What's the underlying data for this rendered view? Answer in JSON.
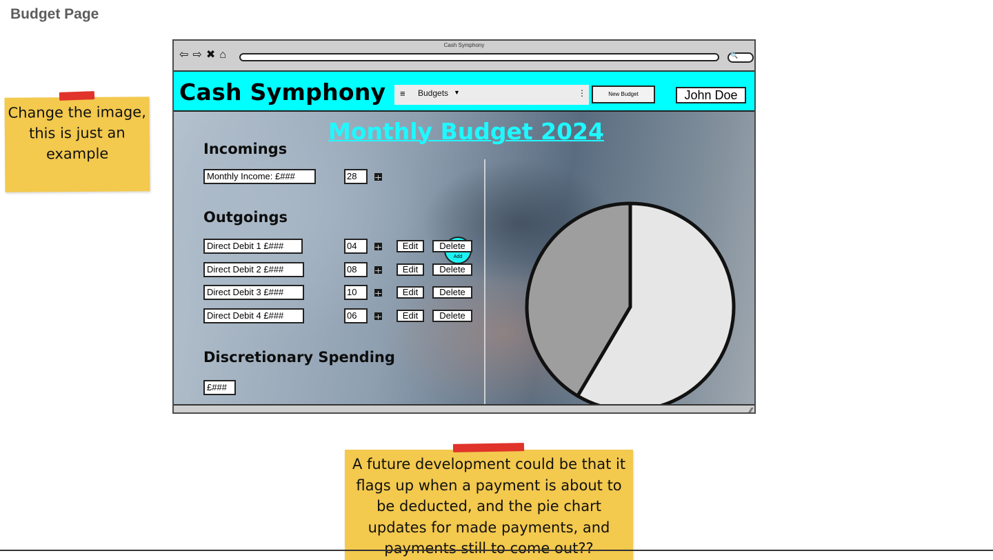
{
  "page_label": "Budget Page",
  "notes": {
    "image_note": "Change the image, this is just an example",
    "future_note": "A future development could be that it flags up when a payment is about to be deducted, and the pie chart updates for made payments, and payments still to come out??"
  },
  "browser": {
    "window_title": "Cash Symphony",
    "nav_icons": [
      "back-icon",
      "forward-icon",
      "close-icon",
      "home-icon"
    ]
  },
  "header": {
    "brand": "Cash Symphony",
    "menu_label": "Budgets",
    "new_budget_label": "New Budget",
    "user_name": "John Doe"
  },
  "main": {
    "title": "Monthly Budget 2024",
    "incomings": {
      "heading": "Incomings",
      "income_field": "Monthly Income: £###",
      "day": "28"
    },
    "outgoings": {
      "heading": "Outgoings",
      "add_label": "Add",
      "edit_label": "Edit",
      "delete_label": "Delete",
      "items": [
        {
          "label": "Direct Debit 1 £###",
          "day": "04"
        },
        {
          "label": "Direct Debit 2 £###",
          "day": "08"
        },
        {
          "label": "Direct Debit 3 £###",
          "day": "10"
        },
        {
          "label": "Direct Debit 4 £###",
          "day": "06"
        }
      ]
    },
    "discretionary": {
      "heading": "Discretionary Spending",
      "value": "£###"
    }
  },
  "pie_chart": {
    "slices": [
      {
        "share": 0.585,
        "color": "#e6e6e6"
      },
      {
        "share": 0.415,
        "color": "#9e9e9e"
      }
    ]
  }
}
